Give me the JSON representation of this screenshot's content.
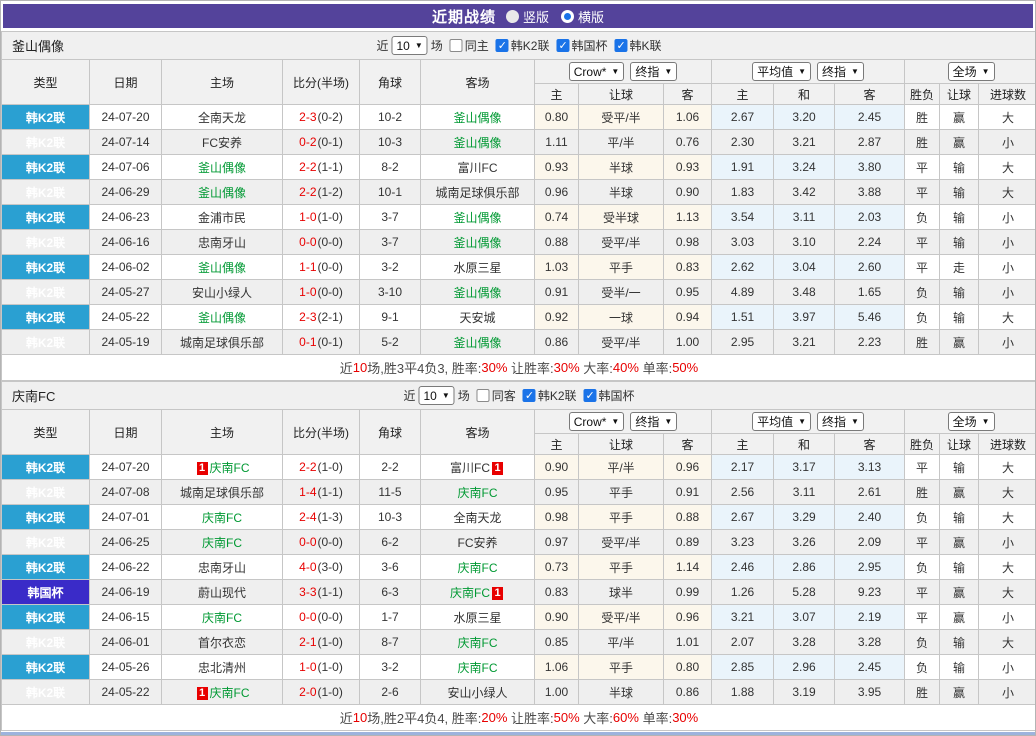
{
  "colors": {
    "accent_purple": "#54439b",
    "league_cyan": "#2aa0d2",
    "cup_blue": "#3a2bc8",
    "self_green": "#009933",
    "score_red": "#e80000",
    "result_blue": "#2323cc",
    "hcp_red": "#e05b5b",
    "hcp_blue": "#4747cc",
    "check_blue": "#1a73e8",
    "odds_bg": "#fcf7ec",
    "avg_bg": "#eaf4fb"
  },
  "topbar": {
    "title": "近期战绩",
    "radios": [
      {
        "label": "竖版",
        "checked": false
      },
      {
        "label": "横版",
        "checked": true
      }
    ]
  },
  "table_header": {
    "cols": [
      "类型",
      "日期",
      "主场",
      "比分(半场)",
      "角球",
      "客场"
    ],
    "odds_group": {
      "select1": "Crow*",
      "select2": "终指",
      "subs": [
        "主",
        "让球",
        "客"
      ]
    },
    "avg_group": {
      "select1": "平均值",
      "select2": "终指",
      "subs": [
        "主",
        "和",
        "客"
      ]
    },
    "full_group": {
      "select": "全场",
      "subs": [
        "胜负",
        "让球",
        "进球数"
      ]
    }
  },
  "sections": [
    {
      "team": "釜山偶像",
      "filter": {
        "prefix": "近",
        "count": "10",
        "suffix": "场",
        "same": {
          "label": "同主",
          "checked": false
        },
        "leagues": [
          {
            "label": "韩K2联",
            "checked": true
          },
          {
            "label": "韩国杯",
            "checked": true
          },
          {
            "label": "韩K联",
            "checked": true
          }
        ]
      },
      "rows": [
        {
          "type": "韩K2联",
          "cup": false,
          "date": "24-07-20",
          "home": "全南天龙",
          "home_self": false,
          "home_badge": "",
          "ft": "2-3",
          "ht": "(0-2)",
          "corner": "10-2",
          "away": "釜山偶像",
          "away_self": true,
          "away_badge": "",
          "o": [
            "0.80",
            "受平/半",
            "1.06"
          ],
          "avg": [
            "2.67",
            "3.20",
            "2.45"
          ],
          "res": [
            [
              "胜",
              "red"
            ],
            [
              "赢",
              "hred"
            ],
            [
              "大",
              "red"
            ]
          ]
        },
        {
          "type": "韩K2联",
          "cup": false,
          "date": "24-07-14",
          "home": "FC安养",
          "home_self": false,
          "home_badge": "",
          "ft": "0-2",
          "ht": "(0-1)",
          "corner": "10-3",
          "away": "釜山偶像",
          "away_self": true,
          "away_badge": "",
          "o": [
            "1.11",
            "平/半",
            "0.76"
          ],
          "avg": [
            "2.30",
            "3.21",
            "2.87"
          ],
          "res": [
            [
              "胜",
              "red"
            ],
            [
              "赢",
              "hred"
            ],
            [
              "小",
              "blue"
            ]
          ]
        },
        {
          "type": "韩K2联",
          "cup": false,
          "date": "24-07-06",
          "home": "釜山偶像",
          "home_self": true,
          "home_badge": "",
          "ft": "2-2",
          "ht": "(1-1)",
          "corner": "8-2",
          "away": "富川FC",
          "away_self": false,
          "away_badge": "",
          "o": [
            "0.93",
            "半球",
            "0.93"
          ],
          "avg": [
            "1.91",
            "3.24",
            "3.80"
          ],
          "res": [
            [
              "平",
              "green"
            ],
            [
              "输",
              "hblue"
            ],
            [
              "大",
              "red"
            ]
          ]
        },
        {
          "type": "韩K2联",
          "cup": false,
          "date": "24-06-29",
          "home": "釜山偶像",
          "home_self": true,
          "home_badge": "",
          "ft": "2-2",
          "ht": "(1-2)",
          "corner": "10-1",
          "away": "城南足球俱乐部",
          "away_self": false,
          "away_badge": "",
          "o": [
            "0.96",
            "半球",
            "0.90"
          ],
          "avg": [
            "1.83",
            "3.42",
            "3.88"
          ],
          "res": [
            [
              "平",
              "green"
            ],
            [
              "输",
              "hblue"
            ],
            [
              "大",
              "red"
            ]
          ]
        },
        {
          "type": "韩K2联",
          "cup": false,
          "date": "24-06-23",
          "home": "金浦市民",
          "home_self": false,
          "home_badge": "",
          "ft": "1-0",
          "ht": "(1-0)",
          "corner": "3-7",
          "away": "釜山偶像",
          "away_self": true,
          "away_badge": "",
          "o": [
            "0.74",
            "受半球",
            "1.13"
          ],
          "avg": [
            "3.54",
            "3.11",
            "2.03"
          ],
          "res": [
            [
              "负",
              "blue"
            ],
            [
              "输",
              "hblue"
            ],
            [
              "小",
              "blue"
            ]
          ]
        },
        {
          "type": "韩K2联",
          "cup": false,
          "date": "24-06-16",
          "home": "忠南牙山",
          "home_self": false,
          "home_badge": "",
          "ft": "0-0",
          "ht": "(0-0)",
          "corner": "3-7",
          "away": "釜山偶像",
          "away_self": true,
          "away_badge": "",
          "o": [
            "0.88",
            "受平/半",
            "0.98"
          ],
          "avg": [
            "3.03",
            "3.10",
            "2.24"
          ],
          "res": [
            [
              "平",
              "green"
            ],
            [
              "输",
              "hblue"
            ],
            [
              "小",
              "blue"
            ]
          ]
        },
        {
          "type": "韩K2联",
          "cup": false,
          "date": "24-06-02",
          "home": "釜山偶像",
          "home_self": true,
          "home_badge": "",
          "ft": "1-1",
          "ht": "(0-0)",
          "corner": "3-2",
          "away": "水原三星",
          "away_self": false,
          "away_badge": "",
          "o": [
            "1.03",
            "平手",
            "0.83"
          ],
          "avg": [
            "2.62",
            "3.04",
            "2.60"
          ],
          "res": [
            [
              "平",
              "green"
            ],
            [
              "走",
              "green"
            ],
            [
              "小",
              "blue"
            ]
          ]
        },
        {
          "type": "韩K2联",
          "cup": false,
          "date": "24-05-27",
          "home": "安山小绿人",
          "home_self": false,
          "home_badge": "",
          "ft": "1-0",
          "ht": "(0-0)",
          "corner": "3-10",
          "away": "釜山偶像",
          "away_self": true,
          "away_badge": "",
          "o": [
            "0.91",
            "受半/一",
            "0.95"
          ],
          "avg": [
            "4.89",
            "3.48",
            "1.65"
          ],
          "res": [
            [
              "负",
              "blue"
            ],
            [
              "输",
              "hblue"
            ],
            [
              "小",
              "blue"
            ]
          ]
        },
        {
          "type": "韩K2联",
          "cup": false,
          "date": "24-05-22",
          "home": "釜山偶像",
          "home_self": true,
          "home_badge": "",
          "ft": "2-3",
          "ht": "(2-1)",
          "corner": "9-1",
          "away": "天安城",
          "away_self": false,
          "away_badge": "",
          "o": [
            "0.92",
            "一球",
            "0.94"
          ],
          "avg": [
            "1.51",
            "3.97",
            "5.46"
          ],
          "res": [
            [
              "负",
              "blue"
            ],
            [
              "输",
              "hblue"
            ],
            [
              "大",
              "red"
            ]
          ]
        },
        {
          "type": "韩K2联",
          "cup": false,
          "date": "24-05-19",
          "home": "城南足球俱乐部",
          "home_self": false,
          "home_badge": "",
          "ft": "0-1",
          "ht": "(0-1)",
          "corner": "5-2",
          "away": "釜山偶像",
          "away_self": true,
          "away_badge": "",
          "o": [
            "0.86",
            "受平/半",
            "1.00"
          ],
          "avg": [
            "2.95",
            "3.21",
            "2.23"
          ],
          "res": [
            [
              "胜",
              "red"
            ],
            [
              "赢",
              "hred"
            ],
            [
              "小",
              "blue"
            ]
          ]
        }
      ],
      "summary": [
        [
          "近",
          false
        ],
        [
          "10",
          true
        ],
        [
          "场,胜3平4负3, 胜率:",
          false
        ],
        [
          "30%",
          true
        ],
        [
          " 让胜率:",
          false
        ],
        [
          "30%",
          true
        ],
        [
          " 大率:",
          false
        ],
        [
          "40%",
          true
        ],
        [
          " 单率:",
          false
        ],
        [
          "50%",
          true
        ]
      ]
    },
    {
      "team": "庆南FC",
      "filter": {
        "prefix": "近",
        "count": "10",
        "suffix": "场",
        "same": {
          "label": "同客",
          "checked": false
        },
        "leagues": [
          {
            "label": "韩K2联",
            "checked": true
          },
          {
            "label": "韩国杯",
            "checked": true
          }
        ]
      },
      "rows": [
        {
          "type": "韩K2联",
          "cup": false,
          "date": "24-07-20",
          "home": "庆南FC",
          "home_self": true,
          "home_badge": "1",
          "ft": "2-2",
          "ht": "(1-0)",
          "corner": "2-2",
          "away": "富川FC",
          "away_self": false,
          "away_badge": "1",
          "o": [
            "0.90",
            "平/半",
            "0.96"
          ],
          "avg": [
            "2.17",
            "3.17",
            "3.13"
          ],
          "res": [
            [
              "平",
              "green"
            ],
            [
              "输",
              "hblue"
            ],
            [
              "大",
              "red"
            ]
          ]
        },
        {
          "type": "韩K2联",
          "cup": false,
          "date": "24-07-08",
          "home": "城南足球俱乐部",
          "home_self": false,
          "home_badge": "",
          "ft": "1-4",
          "ht": "(1-1)",
          "corner": "11-5",
          "away": "庆南FC",
          "away_self": true,
          "away_badge": "",
          "o": [
            "0.95",
            "平手",
            "0.91"
          ],
          "avg": [
            "2.56",
            "3.11",
            "2.61"
          ],
          "res": [
            [
              "胜",
              "red"
            ],
            [
              "赢",
              "hred"
            ],
            [
              "大",
              "red"
            ]
          ]
        },
        {
          "type": "韩K2联",
          "cup": false,
          "date": "24-07-01",
          "home": "庆南FC",
          "home_self": true,
          "home_badge": "",
          "ft": "2-4",
          "ht": "(1-3)",
          "corner": "10-3",
          "away": "全南天龙",
          "away_self": false,
          "away_badge": "",
          "o": [
            "0.98",
            "平手",
            "0.88"
          ],
          "avg": [
            "2.67",
            "3.29",
            "2.40"
          ],
          "res": [
            [
              "负",
              "blue"
            ],
            [
              "输",
              "hblue"
            ],
            [
              "大",
              "red"
            ]
          ]
        },
        {
          "type": "韩K2联",
          "cup": false,
          "date": "24-06-25",
          "home": "庆南FC",
          "home_self": true,
          "home_badge": "",
          "ft": "0-0",
          "ht": "(0-0)",
          "corner": "6-2",
          "away": "FC安养",
          "away_self": false,
          "away_badge": "",
          "o": [
            "0.97",
            "受平/半",
            "0.89"
          ],
          "avg": [
            "3.23",
            "3.26",
            "2.09"
          ],
          "res": [
            [
              "平",
              "green"
            ],
            [
              "赢",
              "hred"
            ],
            [
              "小",
              "blue"
            ]
          ]
        },
        {
          "type": "韩K2联",
          "cup": false,
          "date": "24-06-22",
          "home": "忠南牙山",
          "home_self": false,
          "home_badge": "",
          "ft": "4-0",
          "ht": "(3-0)",
          "corner": "3-6",
          "away": "庆南FC",
          "away_self": true,
          "away_badge": "",
          "o": [
            "0.73",
            "平手",
            "1.14"
          ],
          "avg": [
            "2.46",
            "2.86",
            "2.95"
          ],
          "res": [
            [
              "负",
              "blue"
            ],
            [
              "输",
              "hblue"
            ],
            [
              "大",
              "red"
            ]
          ]
        },
        {
          "type": "韩国杯",
          "cup": true,
          "date": "24-06-19",
          "home": "蔚山现代",
          "home_self": false,
          "home_badge": "",
          "ft": "3-3",
          "ht": "(1-1)",
          "corner": "6-3",
          "away": "庆南FC",
          "away_self": true,
          "away_badge": "1",
          "o": [
            "0.83",
            "球半",
            "0.99"
          ],
          "avg": [
            "1.26",
            "5.28",
            "9.23"
          ],
          "res": [
            [
              "平",
              "green"
            ],
            [
              "赢",
              "hred"
            ],
            [
              "大",
              "red"
            ]
          ]
        },
        {
          "type": "韩K2联",
          "cup": false,
          "date": "24-06-15",
          "home": "庆南FC",
          "home_self": true,
          "home_badge": "",
          "ft": "0-0",
          "ht": "(0-0)",
          "corner": "1-7",
          "away": "水原三星",
          "away_self": false,
          "away_badge": "",
          "o": [
            "0.90",
            "受平/半",
            "0.96"
          ],
          "avg": [
            "3.21",
            "3.07",
            "2.19"
          ],
          "res": [
            [
              "平",
              "green"
            ],
            [
              "赢",
              "hred"
            ],
            [
              "小",
              "blue"
            ]
          ]
        },
        {
          "type": "韩K2联",
          "cup": false,
          "date": "24-06-01",
          "home": "首尔衣恋",
          "home_self": false,
          "home_badge": "",
          "ft": "2-1",
          "ht": "(1-0)",
          "corner": "8-7",
          "away": "庆南FC",
          "away_self": true,
          "away_badge": "",
          "o": [
            "0.85",
            "平/半",
            "1.01"
          ],
          "avg": [
            "2.07",
            "3.28",
            "3.28"
          ],
          "res": [
            [
              "负",
              "blue"
            ],
            [
              "输",
              "hblue"
            ],
            [
              "大",
              "red"
            ]
          ]
        },
        {
          "type": "韩K2联",
          "cup": false,
          "date": "24-05-26",
          "home": "忠北清州",
          "home_self": false,
          "home_badge": "",
          "ft": "1-0",
          "ht": "(1-0)",
          "corner": "3-2",
          "away": "庆南FC",
          "away_self": true,
          "away_badge": "",
          "o": [
            "1.06",
            "平手",
            "0.80"
          ],
          "avg": [
            "2.85",
            "2.96",
            "2.45"
          ],
          "res": [
            [
              "负",
              "blue"
            ],
            [
              "输",
              "hblue"
            ],
            [
              "小",
              "blue"
            ]
          ]
        },
        {
          "type": "韩K2联",
          "cup": false,
          "date": "24-05-22",
          "home": "庆南FC",
          "home_self": true,
          "home_badge": "1",
          "ft": "2-0",
          "ht": "(1-0)",
          "corner": "2-6",
          "away": "安山小绿人",
          "away_self": false,
          "away_badge": "",
          "o": [
            "1.00",
            "半球",
            "0.86"
          ],
          "avg": [
            "1.88",
            "3.19",
            "3.95"
          ],
          "res": [
            [
              "胜",
              "red"
            ],
            [
              "赢",
              "hred"
            ],
            [
              "小",
              "blue"
            ]
          ]
        }
      ],
      "summary": [
        [
          "近",
          false
        ],
        [
          "10",
          true
        ],
        [
          "场,胜2平4负4, 胜率:",
          false
        ],
        [
          "20%",
          true
        ],
        [
          " 让胜率:",
          false
        ],
        [
          "50%",
          true
        ],
        [
          " 大率:",
          false
        ],
        [
          "60%",
          true
        ],
        [
          " 单率:",
          false
        ],
        [
          "30%",
          true
        ]
      ]
    }
  ]
}
